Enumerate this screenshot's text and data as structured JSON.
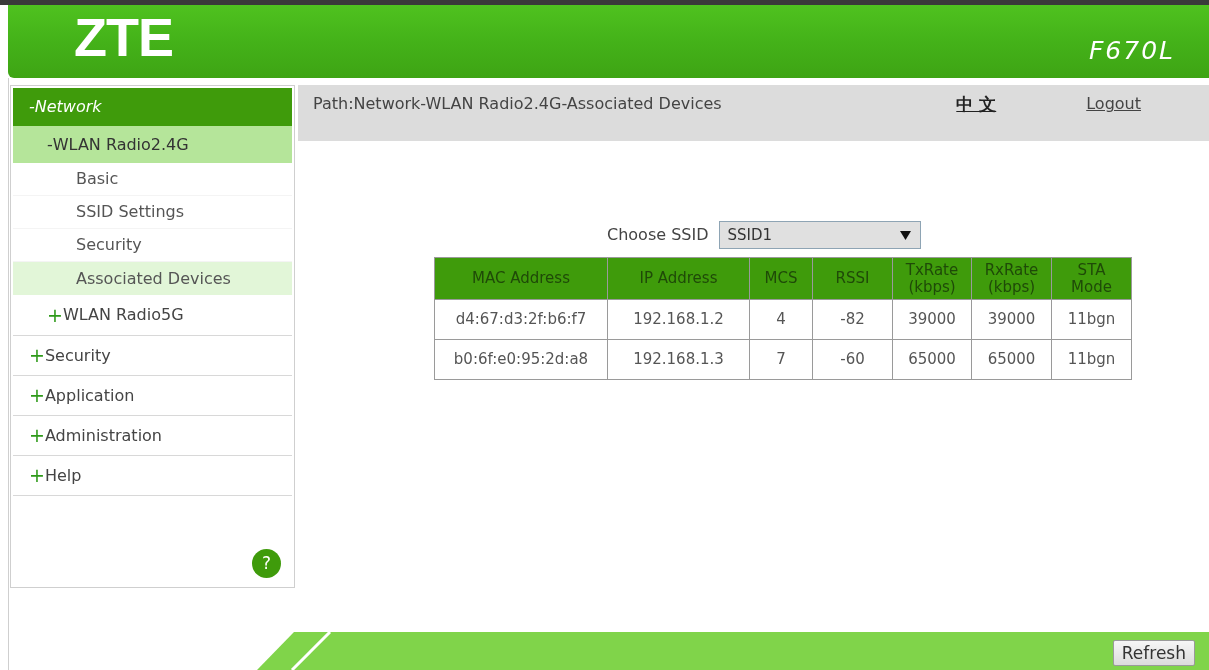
{
  "header": {
    "logo": "ZTE",
    "model": "F670L"
  },
  "sidebar": {
    "items": [
      {
        "marker": "-",
        "label": "Network",
        "expanded": true,
        "children": [
          {
            "marker": "-",
            "label": "WLAN Radio2.4G",
            "expanded": true,
            "children": [
              {
                "label": "Basic",
                "selected": false
              },
              {
                "label": "SSID Settings",
                "selected": false
              },
              {
                "label": "Security",
                "selected": false
              },
              {
                "label": "Associated Devices",
                "selected": true
              }
            ]
          },
          {
            "marker": "+",
            "label": "WLAN Radio5G",
            "expanded": false
          }
        ]
      },
      {
        "marker": "+",
        "label": "Security",
        "expanded": false
      },
      {
        "marker": "+",
        "label": "Application",
        "expanded": false
      },
      {
        "marker": "+",
        "label": "Administration",
        "expanded": false
      },
      {
        "marker": "+",
        "label": "Help",
        "expanded": false
      }
    ],
    "help_button": {
      "symbol": "?"
    }
  },
  "path_bar": {
    "path": "Path:Network-WLAN Radio2.4G-Associated Devices",
    "language_link": "中 文",
    "logout_link": "Logout"
  },
  "ssid_select": {
    "label": "Choose SSID",
    "value": "SSID1"
  },
  "devices_table": {
    "columns": [
      "MAC Address",
      "IP Address",
      "MCS",
      "RSSI",
      "TxRate (kbps)",
      "RxRate (kbps)",
      "STA Mode"
    ],
    "rows": [
      [
        "d4:67:d3:2f:b6:f7",
        "192.168.1.2",
        "4",
        "-82",
        "39000",
        "39000",
        "11bgn"
      ],
      [
        "b0:6f:e0:95:2d:a8",
        "192.168.1.3",
        "7",
        "-60",
        "65000",
        "65000",
        "11bgn"
      ]
    ]
  },
  "footer": {
    "refresh_button": "Refresh"
  }
}
